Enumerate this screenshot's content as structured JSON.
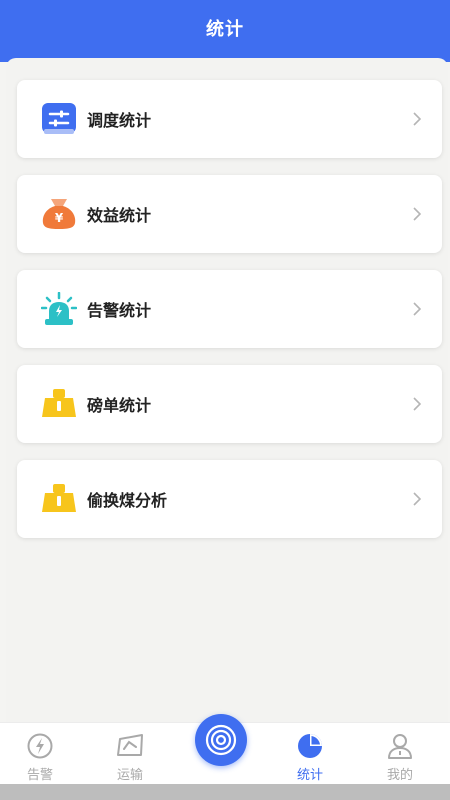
{
  "header": {
    "title": "统计"
  },
  "menu": {
    "items": [
      {
        "label": "调度统计",
        "icon": "sliders-icon"
      },
      {
        "label": "效益统计",
        "icon": "money-bag-icon"
      },
      {
        "label": "告警统计",
        "icon": "alarm-light-icon"
      },
      {
        "label": "磅单统计",
        "icon": "weigh-scale-icon"
      },
      {
        "label": "偷换煤分析",
        "icon": "weigh-scale-icon"
      }
    ]
  },
  "tabbar": {
    "tabs": [
      {
        "label": "告警",
        "icon": "alert-bolt-icon",
        "active": false
      },
      {
        "label": "运输",
        "icon": "transport-icon",
        "active": false
      },
      {
        "label": "统计",
        "icon": "pie-chart-icon",
        "active": true
      },
      {
        "label": "我的",
        "icon": "user-icon",
        "active": false
      }
    ],
    "center_icon": "camera-lens-icon"
  },
  "colors": {
    "primary": "#3f6ef0",
    "orange": "#f07a3a",
    "teal": "#2cc0c6",
    "yellow": "#f7c51c",
    "inactive": "#a9a9a9"
  }
}
